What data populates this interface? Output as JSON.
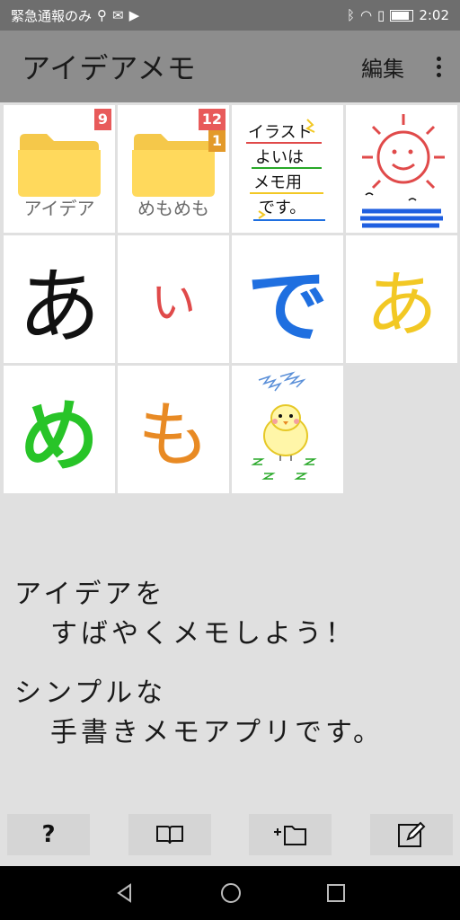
{
  "status": {
    "left": "緊急通報のみ",
    "time": "2:02"
  },
  "app": {
    "title": "アイデアメモ",
    "edit_label": "編集"
  },
  "folders": [
    {
      "name": "アイデア",
      "badge": "9"
    },
    {
      "name": "めもめも",
      "badge": "12",
      "badge2": "1"
    }
  ],
  "memos": {
    "illustration_text": [
      "イラスト",
      "よいは",
      "メモ用",
      "です。"
    ],
    "chars": [
      {
        "text": "あ",
        "color": "#111111"
      },
      {
        "text": "い",
        "color": "#e04a4a"
      },
      {
        "text": "で",
        "color": "#1f6fe0"
      },
      {
        "text": "あ",
        "color": "#f2c824"
      },
      {
        "text": "め",
        "color": "#28c428"
      },
      {
        "text": "も",
        "color": "#e88a24"
      }
    ]
  },
  "tagline": {
    "line1": "アイデアを",
    "line2": "すばやくメモしよう！",
    "line3": "シンプルな",
    "line4": "手書きメモアプリです。"
  },
  "toolbar": {
    "help_label": "?"
  },
  "icons": [
    "help-icon",
    "book-icon",
    "new-folder-icon",
    "new-memo-icon",
    "back-icon",
    "home-icon",
    "recents-icon"
  ]
}
